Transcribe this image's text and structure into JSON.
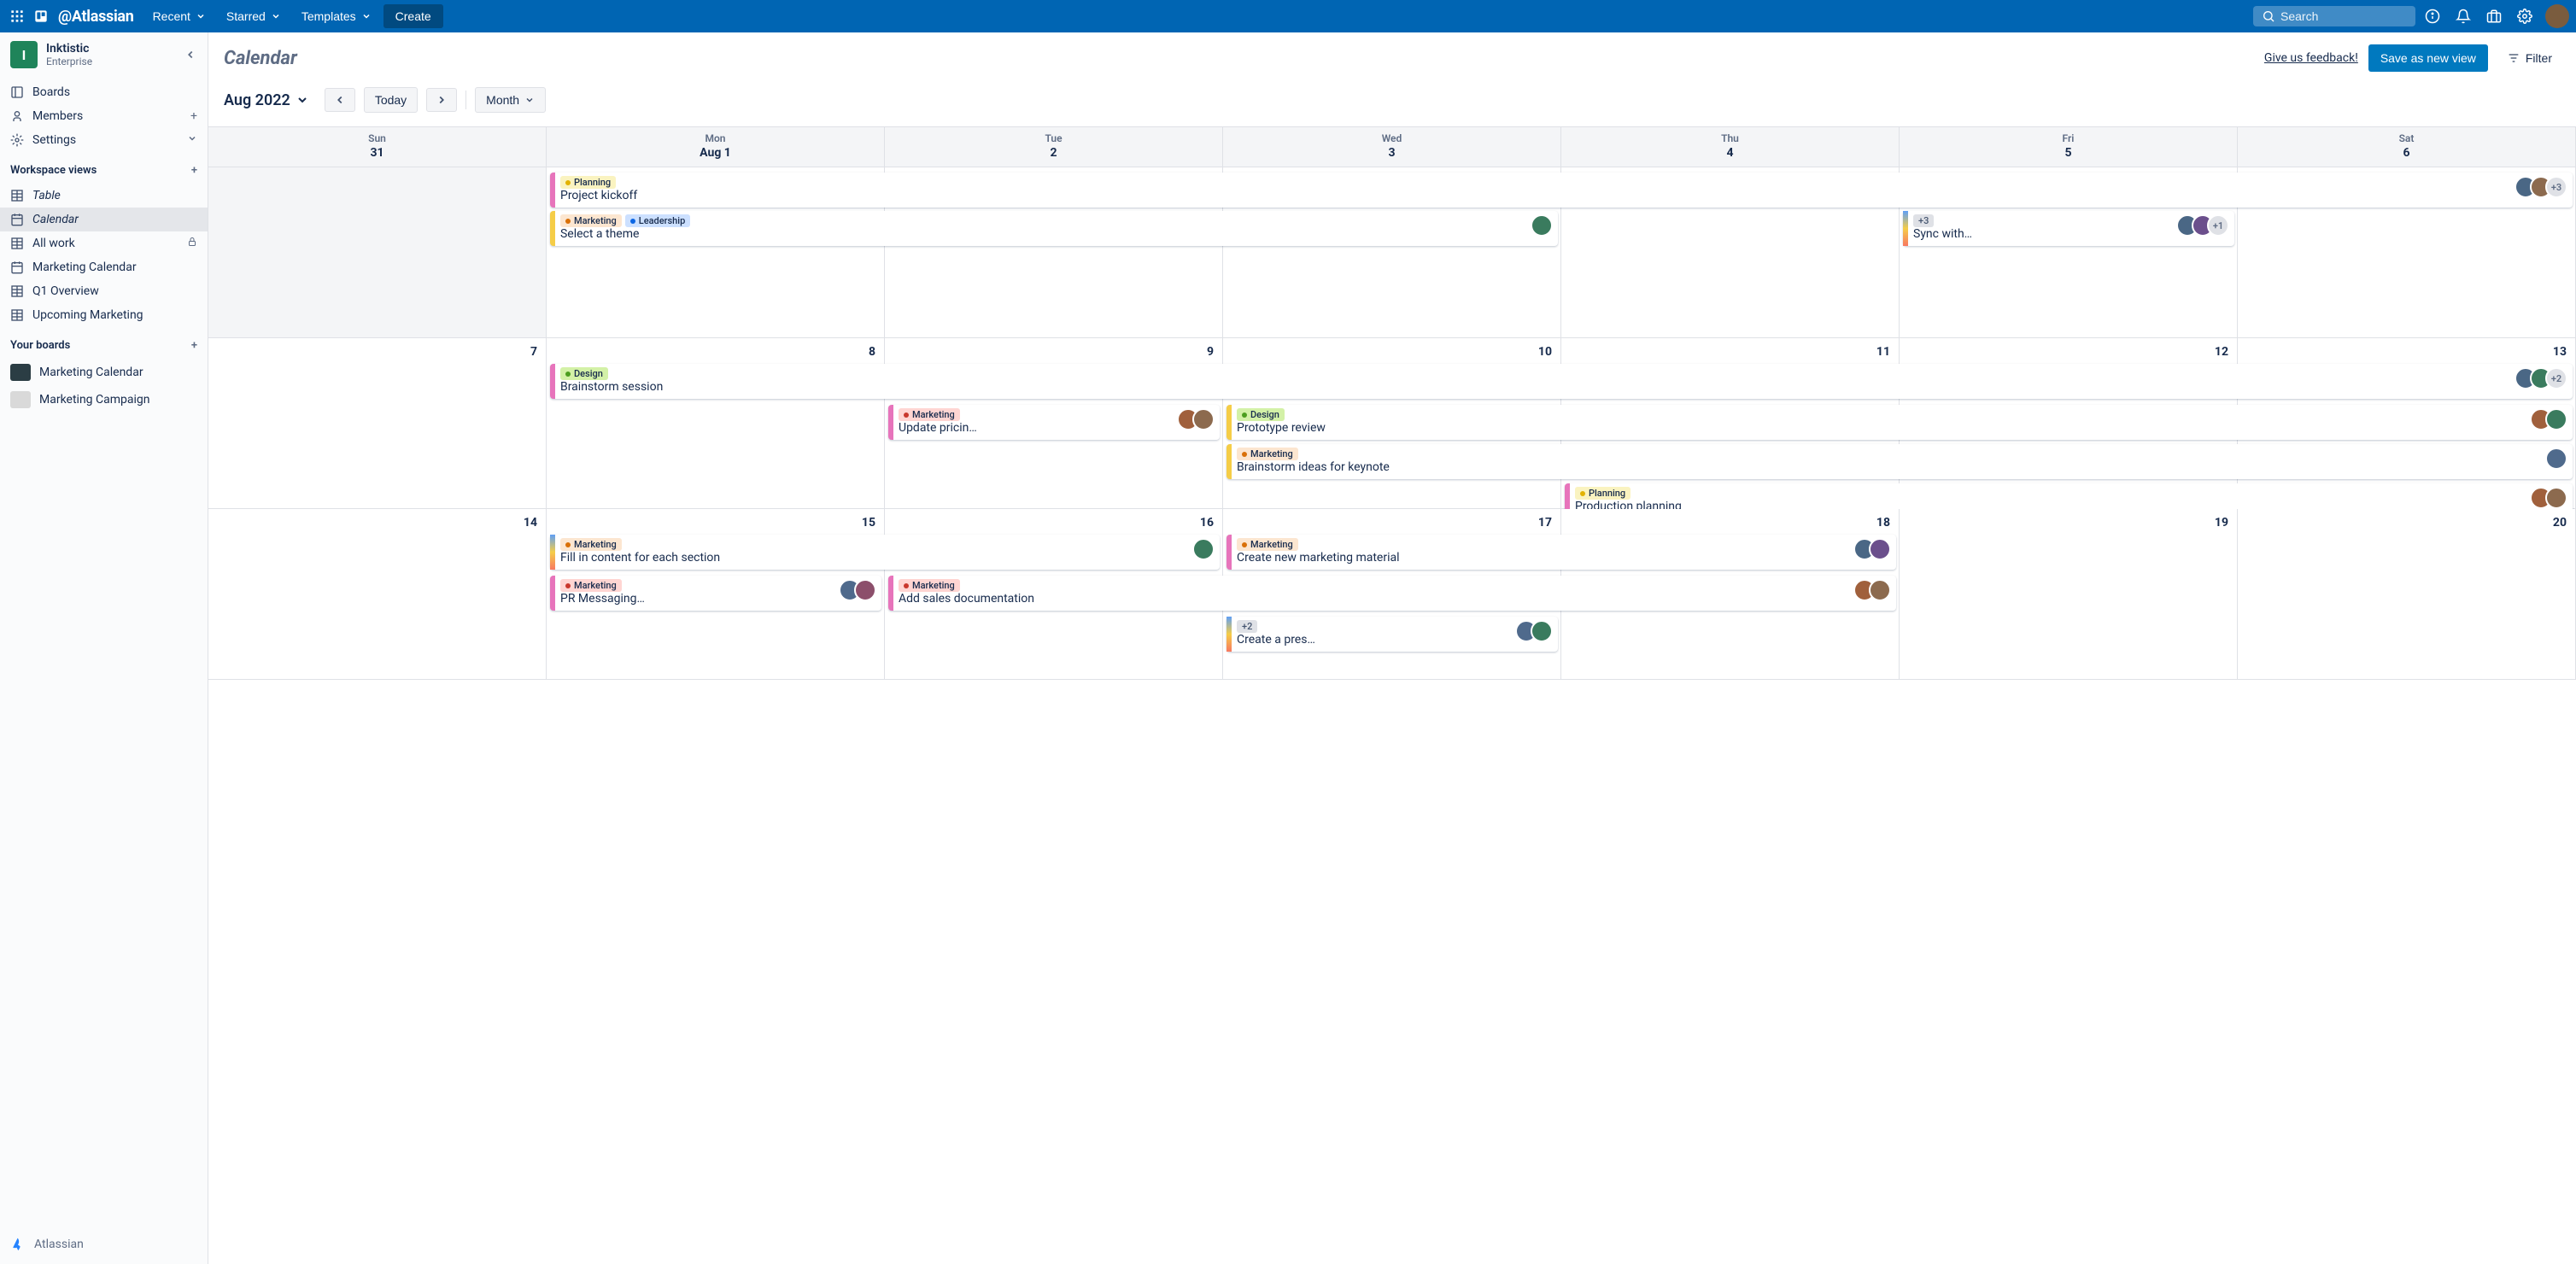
{
  "topbar": {
    "brand": "@Atlassian",
    "nav": {
      "recent": "Recent",
      "starred": "Starred",
      "templates": "Templates"
    },
    "create": "Create",
    "search_placeholder": "Search"
  },
  "workspace": {
    "initial": "I",
    "name": "Inktistic",
    "plan": "Enterprise"
  },
  "sidebar": {
    "boards": "Boards",
    "members": "Members",
    "settings": "Settings",
    "section_views": "Workspace views",
    "views": {
      "table": "Table",
      "calendar": "Calendar",
      "all_work": "All work",
      "marketing_calendar": "Marketing Calendar",
      "q1_overview": "Q1 Overview",
      "upcoming_marketing": "Upcoming Marketing"
    },
    "section_boards": "Your boards",
    "your_boards": {
      "b1": "Marketing Calendar",
      "b2": "Marketing Campaign"
    },
    "footer": "Atlassian"
  },
  "header": {
    "title": "Calendar",
    "feedback": "Give us feedback!",
    "save": "Save as new view",
    "filter": "Filter"
  },
  "toolbar": {
    "month_label": "Aug 2022",
    "today": "Today",
    "view": "Month"
  },
  "cal": {
    "days": [
      "Sun",
      "Mon",
      "Tue",
      "Wed",
      "Thu",
      "Fri",
      "Sat"
    ],
    "header_dates": [
      "31",
      "Aug 1",
      "2",
      "3",
      "4",
      "5",
      "6"
    ],
    "row2": [
      "7",
      "8",
      "9",
      "10",
      "11",
      "12",
      "13"
    ],
    "row3": [
      "14",
      "15",
      "16",
      "17",
      "18",
      "19",
      "20"
    ]
  },
  "labels": {
    "planning": "Planning",
    "marketing": "Marketing",
    "leadership": "Leadership",
    "design": "Design"
  },
  "events": {
    "project_kickoff": "Project kickoff",
    "select_theme": "Select a theme",
    "sync_with": "Sync with…",
    "brainstorm_session": "Brainstorm session",
    "update_pricing": "Update pricin…",
    "prototype_review": "Prototype review",
    "brainstorm_keynote": "Brainstorm ideas for keynote",
    "production_planning": "Production planning",
    "fill_content": "Fill in content for each section",
    "create_marketing": "Create new marketing material",
    "pr_messaging": "PR Messaging…",
    "add_sales_doc": "Add sales documentation",
    "create_pres": "Create a pres…",
    "plus3": "+3",
    "plus1": "+1",
    "plus2": "+2",
    "sync_label_count": "+3"
  }
}
